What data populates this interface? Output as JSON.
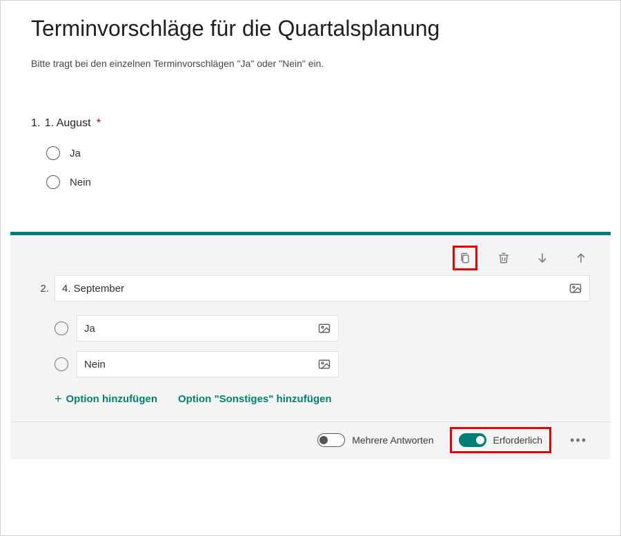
{
  "form": {
    "title": "Terminvorschläge für die Quartalsplanung",
    "description": "Bitte tragt bei den einzelnen Terminvorschlägen \"Ja\" oder \"Nein\" ein."
  },
  "q1": {
    "number": "1.",
    "title": "1. August",
    "required_marker": "*",
    "options": [
      "Ja",
      "Nein"
    ]
  },
  "q2": {
    "number": "2.",
    "title": "4. September",
    "options": [
      "Ja",
      "Nein"
    ],
    "add_option_label": "Option hinzufügen",
    "add_other_label": "Option \"Sonstiges\" hinzufügen"
  },
  "footer": {
    "multiple_label": "Mehrere Antworten",
    "required_label": "Erforderlich"
  },
  "colors": {
    "accent": "#008075",
    "highlight": "#e60000"
  }
}
